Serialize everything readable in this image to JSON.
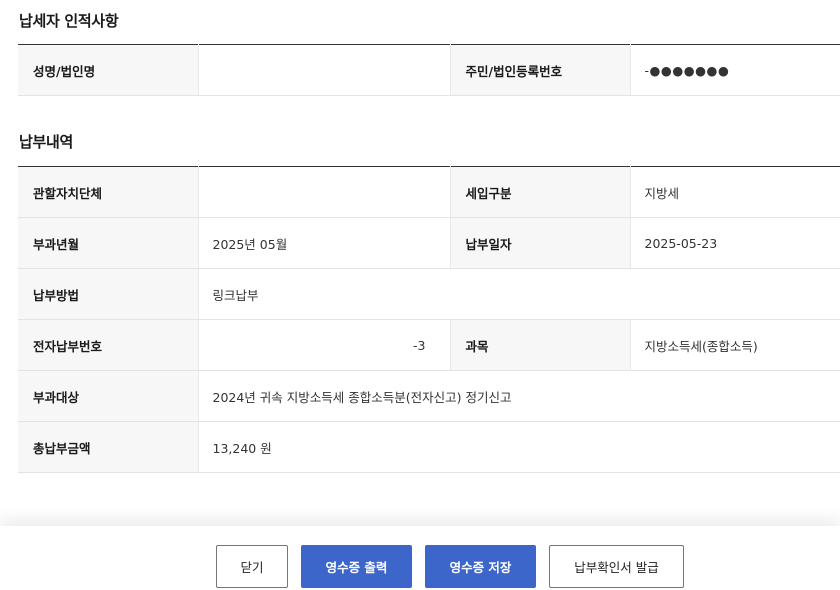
{
  "taxpayer": {
    "title": "납세자 인적사항",
    "name_label": "성명/법인명",
    "name_value": "",
    "id_label": "주민/법인등록번호",
    "id_value": "-●●●●●●●"
  },
  "payment": {
    "title": "납부내역",
    "rows": {
      "jurisdiction_label": "관할자치단체",
      "jurisdiction_value": "",
      "tax_type_label": "세입구분",
      "tax_type_value": "지방세",
      "levy_month_label": "부과년월",
      "levy_month_value": "2025년 05월",
      "pay_date_label": "납부일자",
      "pay_date_value": "2025-05-23",
      "method_label": "납부방법",
      "method_value": "링크납부",
      "epay_no_label": "전자납부번호",
      "epay_no_value": "-3",
      "item_label": "과목",
      "item_value": "지방소득세(종합소득)",
      "target_label": "부과대상",
      "target_value": "2024년 귀속 지방소득세 종합소득분(전자신고) 정기신고",
      "total_label": "총납부금액",
      "total_value": "13,240 원"
    }
  },
  "buttons": {
    "close": "닫기",
    "print_receipt": "영수증 출력",
    "save_receipt": "영수증 저장",
    "issue_confirm": "납부확인서 발급"
  },
  "colors": {
    "primary": "#3c66c9",
    "header_bg": "#f7f7f7",
    "border": "#e3e3e3"
  }
}
